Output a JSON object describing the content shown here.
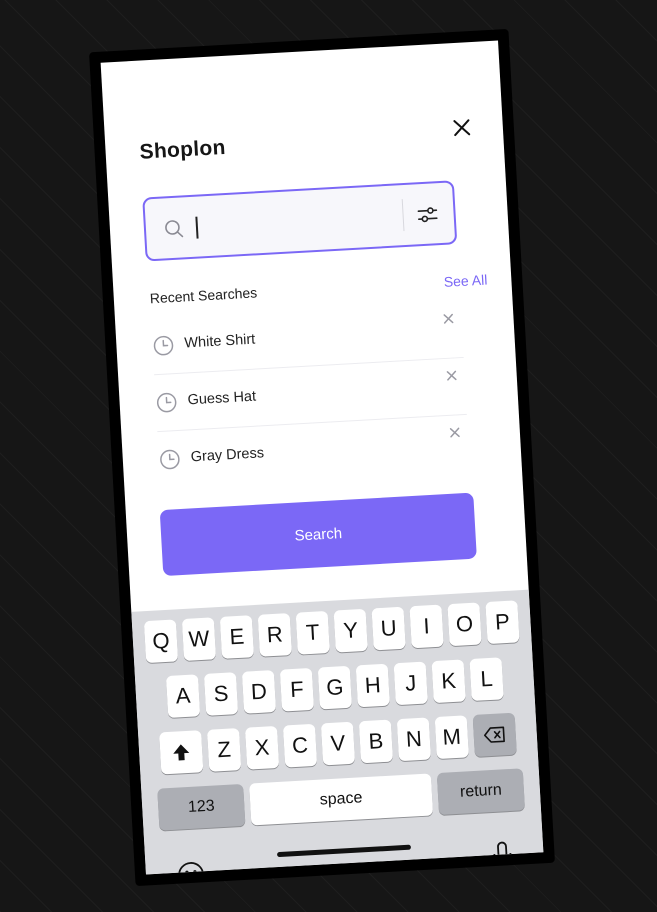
{
  "app": {
    "title": "Shoplon"
  },
  "search": {
    "value": "",
    "placeholder": ""
  },
  "recent": {
    "label": "Recent Searches",
    "see_all": "See All",
    "items": [
      {
        "label": "White Shirt"
      },
      {
        "label": "Guess Hat"
      },
      {
        "label": "Gray Dress"
      }
    ]
  },
  "search_button": {
    "label": "Search"
  },
  "keyboard": {
    "row1": [
      "Q",
      "W",
      "E",
      "R",
      "T",
      "Y",
      "U",
      "I",
      "O",
      "P"
    ],
    "row2": [
      "A",
      "S",
      "D",
      "F",
      "G",
      "H",
      "J",
      "K",
      "L"
    ],
    "row3": [
      "Z",
      "X",
      "C",
      "V",
      "B",
      "N",
      "M"
    ],
    "numbers_label": "123",
    "space_label": "space",
    "return_label": "return"
  },
  "icons": {
    "close": "close-icon",
    "search": "search-icon",
    "filter": "filter-icon",
    "clock": "clock-icon",
    "remove": "remove-icon",
    "shift": "shift-icon",
    "backspace": "backspace-icon",
    "emoji": "emoji-icon",
    "microphone": "microphone-icon"
  },
  "colors": {
    "accent": "#7B68F6",
    "text": "#222222",
    "keyboard_bg": "#D9DADE"
  }
}
